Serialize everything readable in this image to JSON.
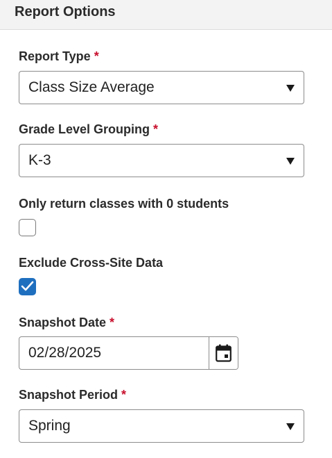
{
  "header": {
    "title": "Report Options"
  },
  "required_marker": "*",
  "fields": {
    "report_type": {
      "label": "Report Type",
      "required": true,
      "value": "Class Size Average"
    },
    "grade_level_grouping": {
      "label": "Grade Level Grouping",
      "required": true,
      "value": "K-3"
    },
    "zero_students": {
      "label": "Only return classes with 0 students",
      "checked": false
    },
    "exclude_cross_site": {
      "label": "Exclude Cross-Site Data",
      "checked": true
    },
    "snapshot_date": {
      "label": "Snapshot Date",
      "required": true,
      "value": "02/28/2025",
      "icon": "calendar-icon"
    },
    "snapshot_period": {
      "label": "Snapshot Period",
      "required": true,
      "value": "Spring"
    }
  },
  "colors": {
    "required": "#c8102e",
    "checkbox_checked": "#1f6fbf",
    "header_bg": "#f3f3f3"
  }
}
